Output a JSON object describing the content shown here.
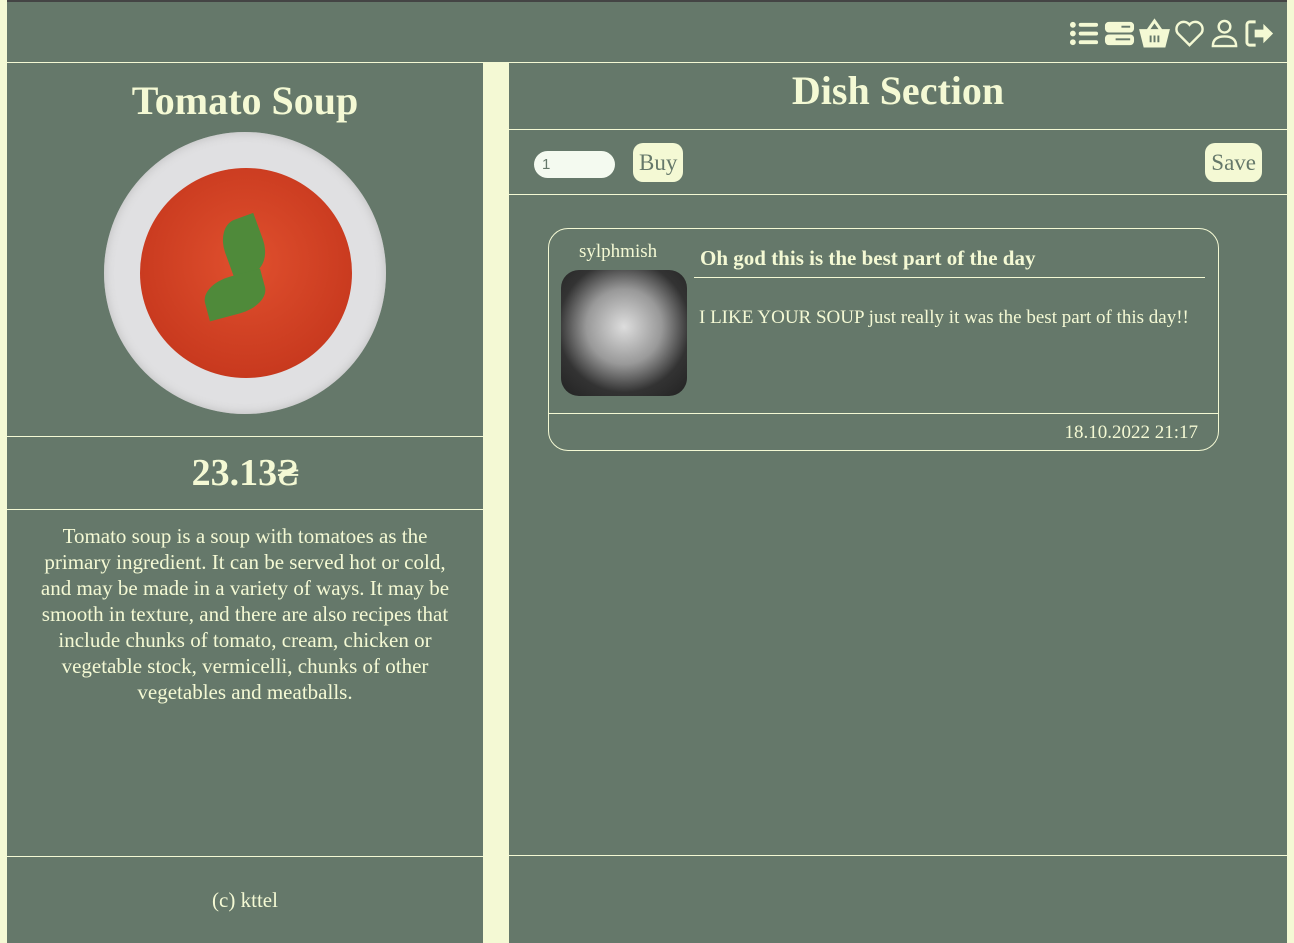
{
  "header": {
    "icons": [
      "list-icon",
      "orders-icon",
      "basket-icon",
      "heart-icon",
      "user-icon",
      "logout-icon"
    ]
  },
  "dish": {
    "name": "Tomato Soup",
    "price": "23.13₴",
    "description": "Tomato soup is a soup with tomatoes as the primary ingredient. It can be served hot or cold, and may be made in a variety of ways. It may be smooth in texture, and there are also recipes that include chunks of tomato, cream, chicken or vegetable stock, vermicelli, chunks of other vegetables and meatballs."
  },
  "footer": {
    "text": "(c) kttel"
  },
  "section": {
    "title": "Dish Section",
    "quantity": "1",
    "buy_label": "Buy",
    "save_label": "Save"
  },
  "comments": [
    {
      "user": "sylphmish",
      "title": "Oh god this is the best part of the day",
      "text": "I LIKE YOUR SOUP just really it was the best part of this day!!",
      "date": "18.10.2022 21:17"
    }
  ]
}
